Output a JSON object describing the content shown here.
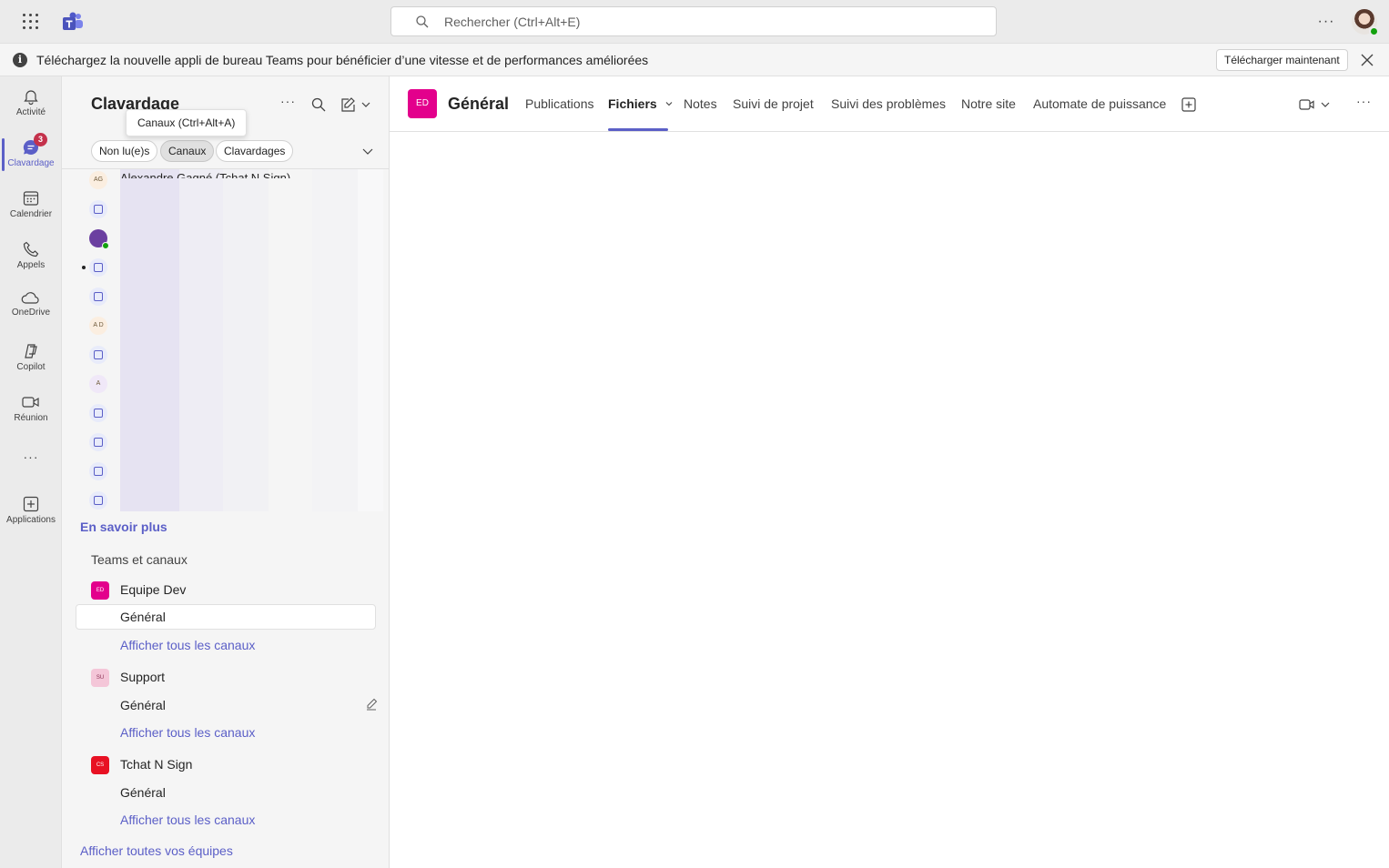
{
  "topbar": {
    "search_placeholder": "Rechercher (Ctrl+Alt+E)",
    "more_label": "···"
  },
  "banner": {
    "message": "Téléchargez la nouvelle appli de bureau Teams pour bénéficier d’une vitesse et de performances améliorées",
    "button_label": "Télécharger maintenant"
  },
  "rail": {
    "items": [
      {
        "label": "Activité",
        "icon": "bell-icon"
      },
      {
        "label": "Clavardage",
        "icon": "chat-icon",
        "badge": "3"
      },
      {
        "label": "Calendrier",
        "icon": "calendar-icon"
      },
      {
        "label": "Appels",
        "icon": "phone-icon"
      },
      {
        "label": "OneDrive",
        "icon": "cloud-icon"
      },
      {
        "label": "Copilot",
        "icon": "copilot-icon"
      },
      {
        "label": "Réunion",
        "icon": "video-icon"
      },
      {
        "label": "Applications",
        "icon": "add-app-icon"
      }
    ],
    "more_label": "···"
  },
  "panel": {
    "title": "Clavardage",
    "tooltip": "Canaux (Ctrl+Alt+A)",
    "filters": [
      "Non lu(e)s",
      "Canaux",
      "Clavardages"
    ],
    "selected_filter": "Canaux",
    "top_chat_partial": "Alexandre Gagné (Tchat N Sign)",
    "chat_avatars": [
      "AG",
      "",
      "",
      "",
      "",
      "A D",
      "",
      "A",
      "",
      "",
      "",
      ""
    ],
    "learn_more": "En savoir plus",
    "section_title": "Teams et canaux",
    "teams": [
      {
        "initials": "ED",
        "name": "Equipe Dev",
        "channel": "Général",
        "show_all": "Afficher tous les canaux",
        "color": "#e3008c"
      },
      {
        "initials": "SU",
        "name": "Support",
        "channel": "Général",
        "show_all": "Afficher tous les canaux",
        "color": "#f4c6d8"
      },
      {
        "initials": "CS",
        "name": "Tchat N Sign",
        "channel": "Général",
        "show_all": "Afficher tous les canaux",
        "color": "#e81123"
      }
    ],
    "all_teams": "Afficher toutes vos équipes"
  },
  "main": {
    "team_initials": "ED",
    "channel_title": "Général",
    "tabs": [
      "Publications",
      "Fichiers",
      "Notes",
      "Suivi de projet",
      "Suivi des problèmes",
      "Notre site",
      "Automate de puissance"
    ],
    "active_tab": "Fichiers"
  },
  "colors": {
    "accent": "#5b5fc7",
    "badge": "#c4314b",
    "presence": "#13a10e"
  }
}
